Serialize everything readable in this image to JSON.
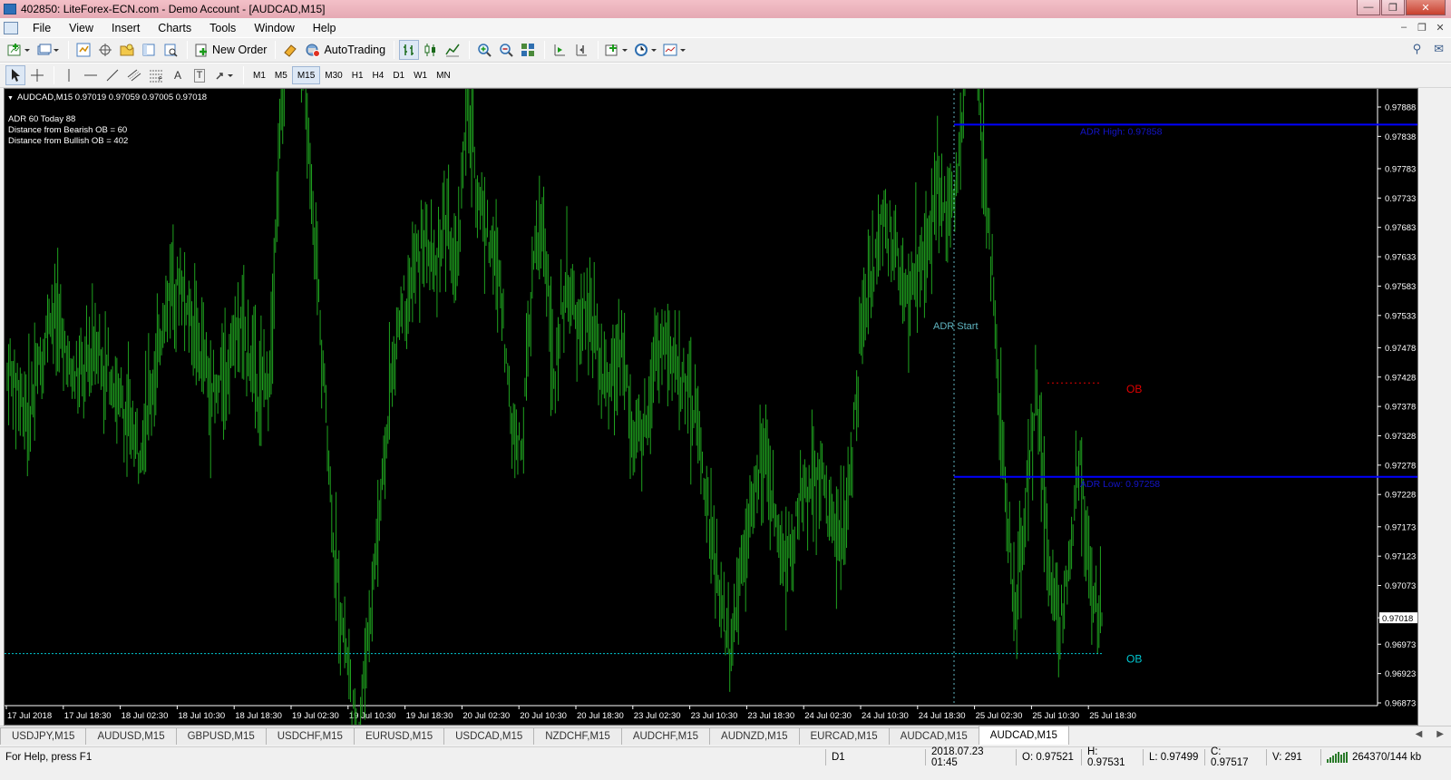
{
  "window": {
    "title": "402850: LiteForex-ECN.com - Demo Account - [AUDCAD,M15]",
    "minimize_icon": "minimize-icon",
    "restore_icon": "restore-icon",
    "close_icon": "close-icon"
  },
  "menu": [
    "File",
    "View",
    "Insert",
    "Charts",
    "Tools",
    "Window",
    "Help"
  ],
  "toolbar1": {
    "new_order": "New Order",
    "autotrading": "AutoTrading"
  },
  "toolbar2": {
    "text_tool": "A",
    "label_tool": "T",
    "timeframes": [
      "M1",
      "M5",
      "M15",
      "M30",
      "H1",
      "H4",
      "D1",
      "W1",
      "MN"
    ],
    "active_timeframe": "M15"
  },
  "chart": {
    "header": "AUDCAD,M15  0.97019 0.97059 0.97005 0.97018",
    "info_lines": [
      "ADR 60  Today 88",
      "Distance from Bearish OB = 60",
      "Distance from Bullish OB = 402"
    ],
    "bar_color": "#1fa31f",
    "adr_high_label": "ADR High: 0.97858",
    "adr_low_label": "ADR Low: 0.97258",
    "adr_start_label": "ADR Start",
    "ob_top_label": "OB",
    "ob_bottom_label": "OB",
    "current_price": "0.97018",
    "colors": {
      "adr_line": "#0000ff",
      "adr_label": "#1414c8",
      "ob_top": "#e00000",
      "ob_bottom": "#00c8d2",
      "adr_start": "#5fb4c0",
      "background": "#000000"
    }
  },
  "chart_data": {
    "type": "bar",
    "symbol": "AUDCAD,M15",
    "ylim": [
      0.96873,
      0.97888
    ],
    "y_ticks": [
      "0.97888",
      "0.97838",
      "0.97783",
      "0.97733",
      "0.97683",
      "0.97633",
      "0.97583",
      "0.97533",
      "0.97478",
      "0.97428",
      "0.97378",
      "0.97328",
      "0.97278",
      "0.97228",
      "0.97173",
      "0.97123",
      "0.97073",
      "0.97018",
      "0.96973",
      "0.96923",
      "0.96873"
    ],
    "x_ticks": [
      "17 Jul 2018",
      "17 Jul 18:30",
      "18 Jul 02:30",
      "18 Jul 10:30",
      "18 Jul 18:30",
      "19 Jul 02:30",
      "19 Jul 10:30",
      "19 Jul 18:30",
      "20 Jul 02:30",
      "20 Jul 10:30",
      "20 Jul 18:30",
      "23 Jul 02:30",
      "23 Jul 10:30",
      "23 Jul 18:30",
      "24 Jul 02:30",
      "24 Jul 10:30",
      "24 Jul 18:30",
      "25 Jul 02:30",
      "25 Jul 10:30",
      "25 Jul 18:30"
    ],
    "series": [
      {
        "name": "AUDCAD,M15",
        "close_path": [
          0.9743,
          0.9742,
          0.9736,
          0.9745,
          0.9755,
          0.975,
          0.9742,
          0.9744,
          0.9749,
          0.9745,
          0.974,
          0.9735,
          0.9731,
          0.974,
          0.975,
          0.976,
          0.9758,
          0.9752,
          0.9745,
          0.9738,
          0.9745,
          0.9752,
          0.9748,
          0.974,
          0.9745,
          0.979,
          0.981,
          0.9795,
          0.977,
          0.974,
          0.971,
          0.9695,
          0.968,
          0.97,
          0.972,
          0.974,
          0.9755,
          0.976,
          0.9765,
          0.976,
          0.977,
          0.976,
          0.979,
          0.9775,
          0.9765,
          0.976,
          0.9735,
          0.973,
          0.976,
          0.977,
          0.974,
          0.976,
          0.975,
          0.9755,
          0.9745,
          0.974,
          0.975,
          0.9735,
          0.973,
          0.9745,
          0.9748,
          0.9745,
          0.9742,
          0.9735,
          0.972,
          0.9705,
          0.9695,
          0.971,
          0.972,
          0.9728,
          0.9722,
          0.971,
          0.9718,
          0.9724,
          0.9728,
          0.972,
          0.9712,
          0.9725,
          0.975,
          0.976,
          0.977,
          0.9765,
          0.9755,
          0.976,
          0.9765,
          0.9775,
          0.977,
          0.978,
          0.981,
          0.9785,
          0.976,
          0.973,
          0.97,
          0.972,
          0.974,
          0.9715,
          0.97,
          0.971,
          0.973,
          0.9705,
          0.9702
        ],
        "bar_count": 760
      }
    ],
    "levels": [
      {
        "name": "ADR High",
        "value": 0.97858
      },
      {
        "name": "ADR Low",
        "value": 0.97258
      },
      {
        "name": "OB bearish",
        "value": 0.97418
      },
      {
        "name": "OB bullish",
        "value": 0.96957
      }
    ],
    "current_price": 0.97018
  },
  "symbol_tabs": [
    "USDJPY,M15",
    "AUDUSD,M15",
    "GBPUSD,M15",
    "USDCHF,M15",
    "EURUSD,M15",
    "USDCAD,M15",
    "NZDCHF,M15",
    "AUDCHF,M15",
    "AUDNZD,M15",
    "EURCAD,M15",
    "AUDCAD,M15",
    "AUDCAD,M15"
  ],
  "active_tab_index": 11,
  "status": {
    "help": "For Help, press F1",
    "profile": "D1",
    "datetime": "2018.07.23 01:45",
    "open": "O: 0.97521",
    "high": "H: 0.97531",
    "low": "L: 0.97499",
    "close": "C: 0.97517",
    "volume": "V: 291",
    "traffic": "264370/144 kb"
  }
}
